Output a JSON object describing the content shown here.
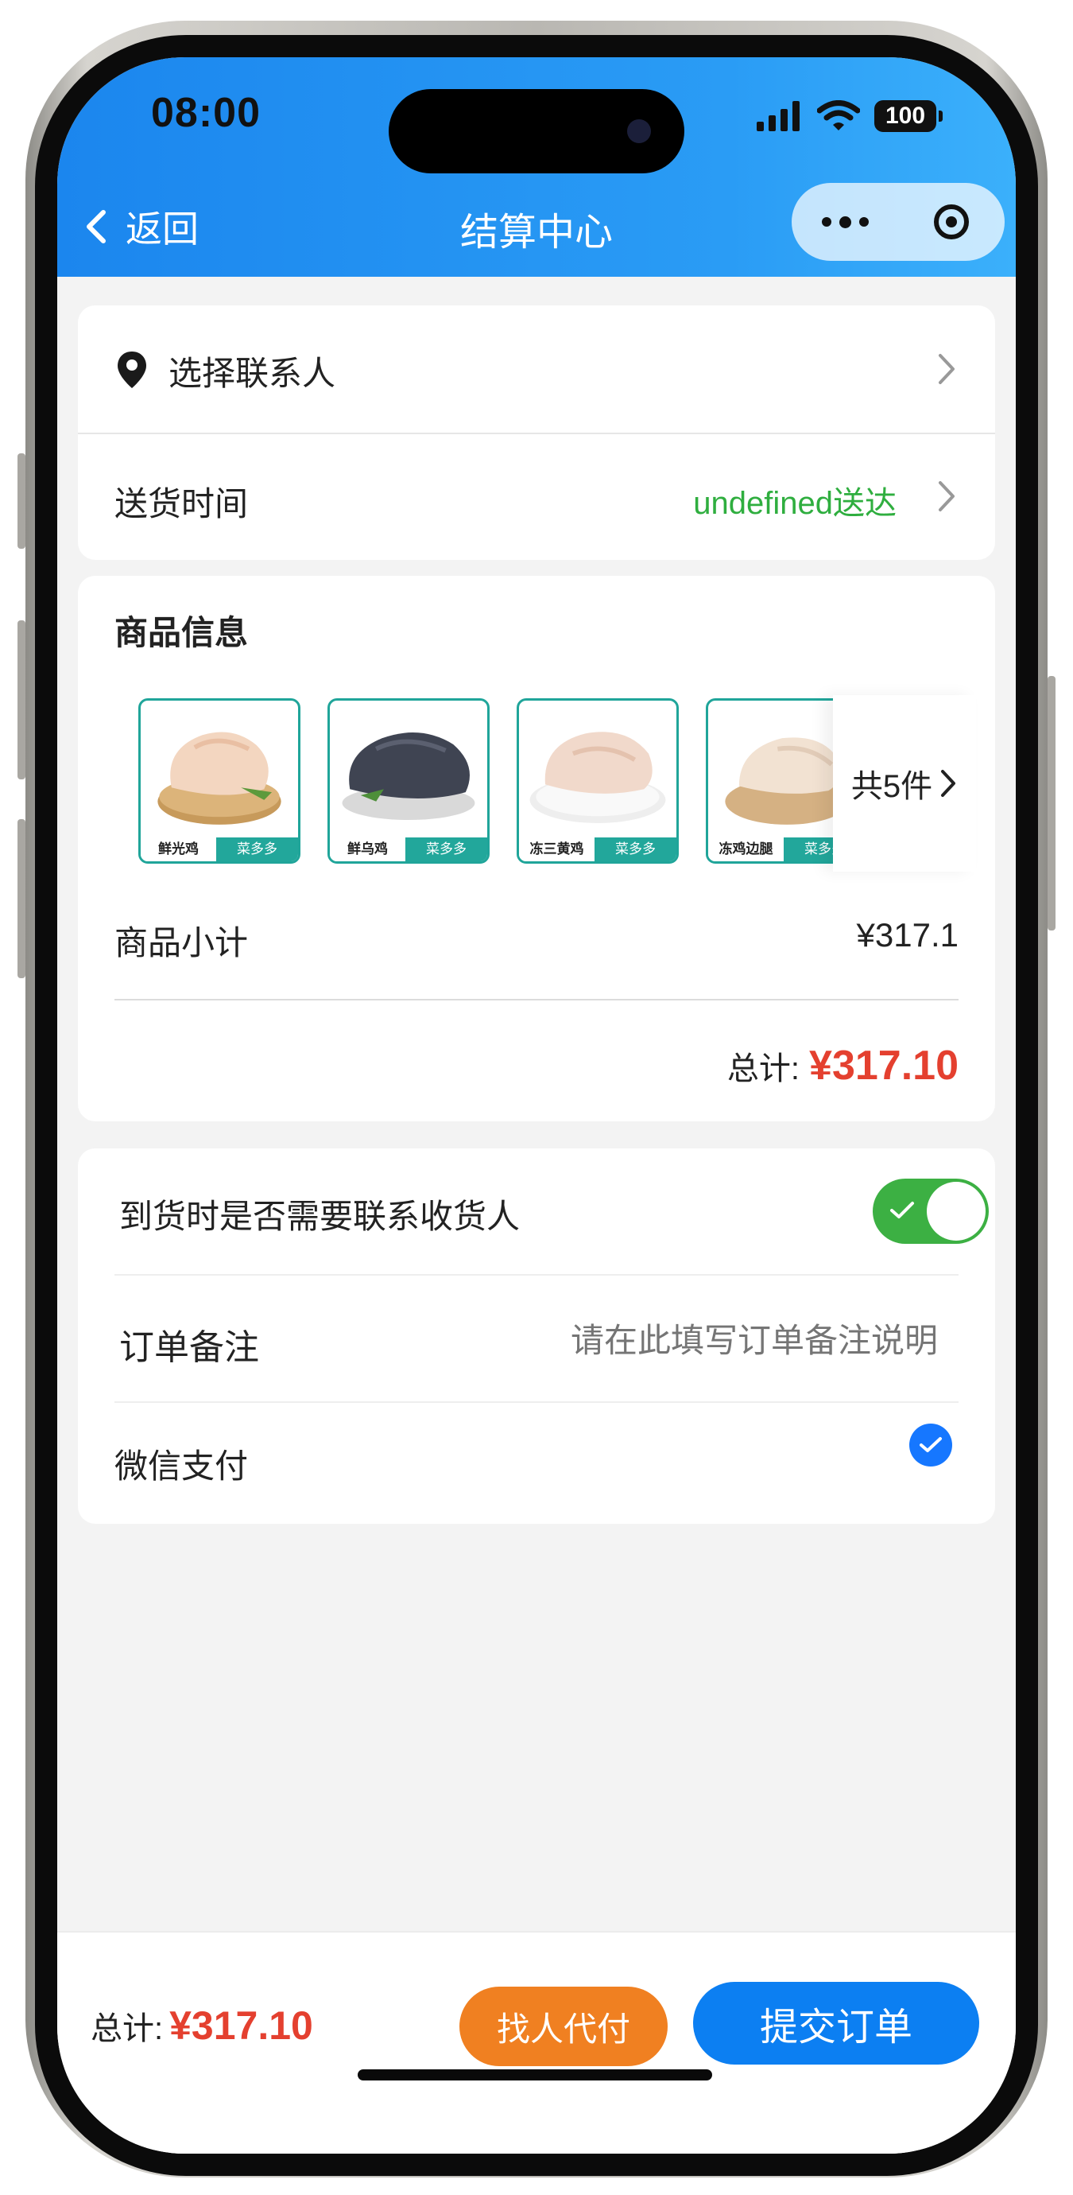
{
  "status_bar": {
    "time": "08:00",
    "battery": "100"
  },
  "nav": {
    "back_label": "返回",
    "title": "结算中心"
  },
  "address": {
    "label": "选择联系人"
  },
  "delivery": {
    "label": "送货时间",
    "value": "undefined送达"
  },
  "products": {
    "title": "商品信息",
    "items": [
      {
        "name": "鲜光鸡",
        "brand": "菜多多"
      },
      {
        "name": "鲜乌鸡",
        "brand": "菜多多"
      },
      {
        "name": "冻三黄鸡",
        "brand": "菜多多"
      },
      {
        "name": "冻鸡边腿",
        "brand": "菜多多"
      }
    ],
    "more_label": "共5件",
    "subtotal_label": "商品小计",
    "subtotal_value": "¥317.1",
    "total_label": "总计:",
    "total_value": "¥317.10"
  },
  "options": {
    "contact_label": "到货时是否需要联系收货人",
    "contact_toggle_on": true,
    "remark_label": "订单备注",
    "remark_placeholder": "请在此填写订单备注说明",
    "payment_label": "微信支付",
    "payment_selected": true
  },
  "footer": {
    "total_label": "总计:",
    "total_value": "¥317.10",
    "proxy_pay_label": "找人代付",
    "submit_label": "提交订单"
  },
  "colors": {
    "header_blue": "#1b86ee",
    "price_red": "#e4402f",
    "delivery_green": "#2fae3f",
    "toggle_green": "#3cb043",
    "orange_button": "#f08021",
    "submit_blue": "#0c7ff2"
  },
  "icons": [
    "back-chevron-icon",
    "more-dots-icon",
    "target-icon",
    "location-pin-icon",
    "chevron-right-icon",
    "check-icon",
    "signal-icon",
    "wifi-icon"
  ]
}
